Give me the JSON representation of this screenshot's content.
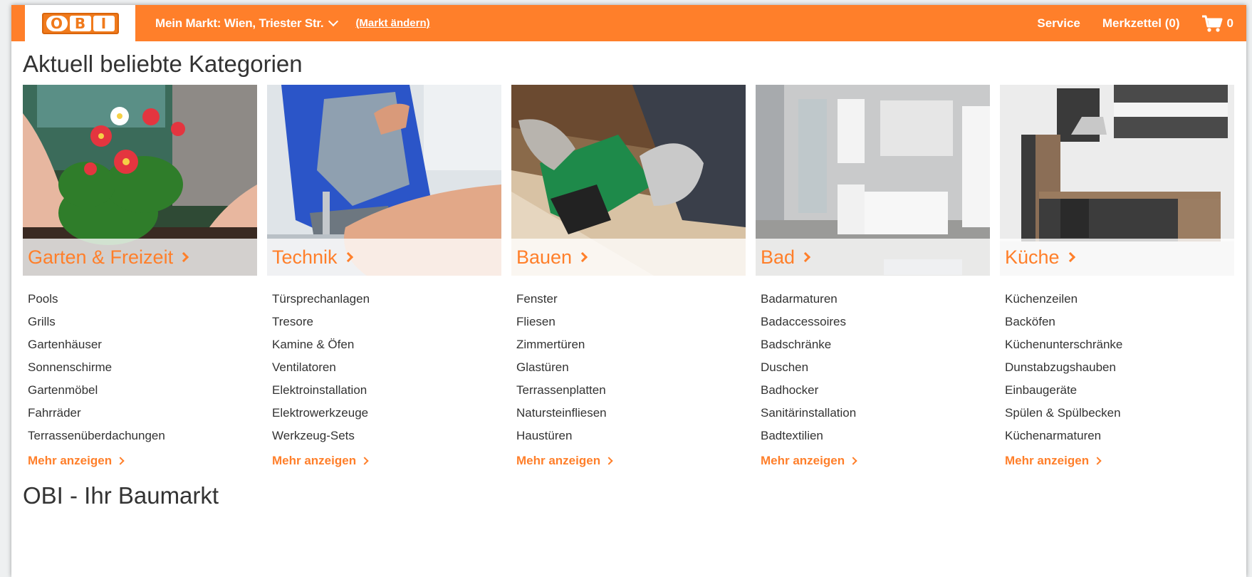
{
  "header": {
    "logo_alt": "OBI",
    "logo_letters": [
      "O",
      "B",
      "I"
    ],
    "market_label": "Mein Markt: Wien, Triester Str.",
    "market_change": "(Markt ändern)",
    "service": "Service",
    "watchlist": "Merkzettel (0)",
    "cart_count": "0"
  },
  "main": {
    "heading": "Aktuell beliebte Kategorien",
    "footer_heading": "OBI - Ihr Baumarkt",
    "categories": [
      {
        "title": "Garten & Freizeit",
        "links": [
          "Pools",
          "Grills",
          "Gartenhäuser",
          "Sonnenschirme",
          "Gartenmöbel",
          "Fahrräder",
          "Terrassenüberdachungen"
        ],
        "more": "Mehr anzeigen"
      },
      {
        "title": "Technik",
        "links": [
          "Türsprechanlagen",
          "Tresore",
          "Kamine & Öfen",
          "Ventilatoren",
          "Elektroinstallation",
          "Elektrowerkzeuge",
          "Werkzeug-Sets"
        ],
        "more": "Mehr anzeigen"
      },
      {
        "title": "Bauen",
        "links": [
          "Fenster",
          "Fliesen",
          "Zimmertüren",
          "Glastüren",
          "Terrassenplatten",
          "Natursteinfliesen",
          "Haustüren"
        ],
        "more": "Mehr anzeigen"
      },
      {
        "title": "Bad",
        "links": [
          "Badarmaturen",
          "Badaccessoires",
          "Badschränke",
          "Duschen",
          "Badhocker",
          "Sanitärinstallation",
          "Badtextilien"
        ],
        "more": "Mehr anzeigen"
      },
      {
        "title": "Küche",
        "links": [
          "Küchenzeilen",
          "Backöfen",
          "Küchenunterschränke",
          "Dunstabzugshauben",
          "Einbaugeräte",
          "Spülen & Spülbecken",
          "Küchenarmaturen"
        ],
        "more": "Mehr anzeigen"
      }
    ]
  },
  "colors": {
    "brand_orange": "#ff7f2a",
    "text": "#333333"
  }
}
